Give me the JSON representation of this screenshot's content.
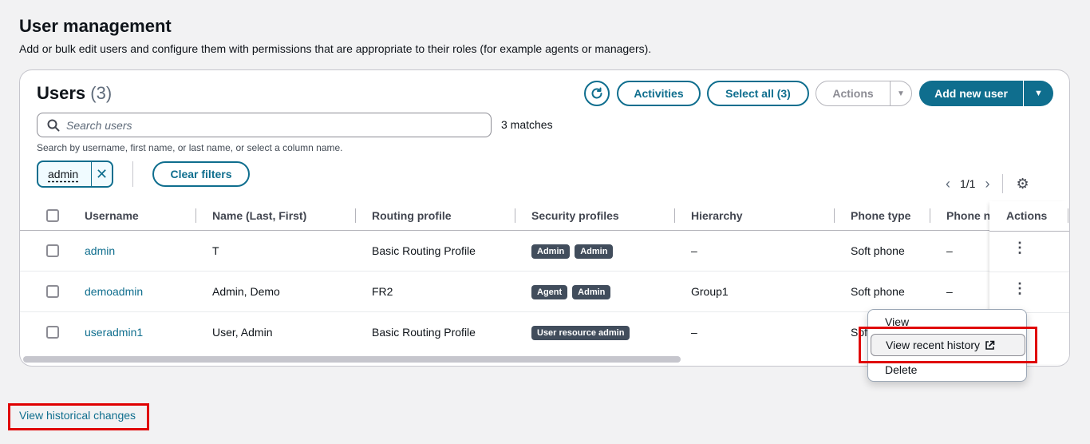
{
  "page": {
    "title": "User management",
    "description": "Add or bulk edit users and configure them with permissions that are appropriate to their roles (for example agents or managers)."
  },
  "panel": {
    "title": "Users",
    "count": "(3)",
    "toolbar": {
      "refresh_icon": "refresh-icon",
      "activities_label": "Activities",
      "select_all_label": "Select all (3)",
      "actions_label": "Actions",
      "add_user_label": "Add new user"
    },
    "search": {
      "placeholder": "Search users",
      "matches": "3 matches",
      "hint": "Search by username, first name, or last name, or select a column name."
    },
    "filter_token": "admin",
    "clear_filters_label": "Clear filters",
    "pagination": "1/1"
  },
  "table": {
    "columns": [
      "Username",
      "Name (Last, First)",
      "Routing profile",
      "Security profiles",
      "Hierarchy",
      "Phone type",
      "Phone n",
      "Actions"
    ],
    "rows": [
      {
        "username": "admin",
        "name": "T",
        "routing": "Basic Routing Profile",
        "security": [
          "Admin",
          "Admin"
        ],
        "hierarchy": "–",
        "phone_type": "Soft phone",
        "phone_number": "–"
      },
      {
        "username": "demoadmin",
        "name": "Admin, Demo",
        "routing": "FR2",
        "security": [
          "Agent",
          "Admin"
        ],
        "hierarchy": "Group1",
        "phone_type": "Soft phone",
        "phone_number": "–"
      },
      {
        "username": "useradmin1",
        "name": "User, Admin",
        "routing": "Basic Routing Profile",
        "security": [
          "User resource admin"
        ],
        "hierarchy": "–",
        "phone_type": "Sof",
        "phone_number": ""
      }
    ]
  },
  "context_menu": {
    "items": [
      "View",
      "View recent history",
      "Delete"
    ],
    "external_icon": "external-link-icon"
  },
  "footer": {
    "link": "View historical changes"
  },
  "colors": {
    "accent": "#0f6e8e",
    "highlight_box": "#e00000",
    "badge_bg": "#414d5c"
  }
}
